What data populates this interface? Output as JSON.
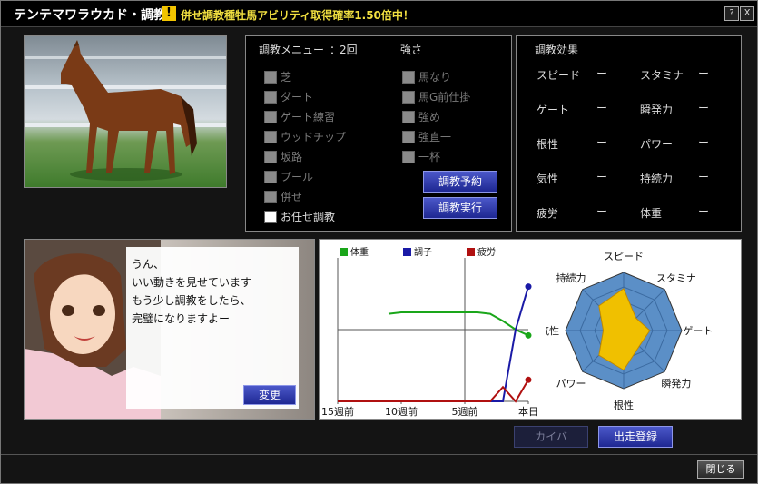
{
  "titlebar": {
    "title": "テンテマワラウカド・調教",
    "warning_glyph": "!",
    "ticker": "併せ調教種牡馬アビリティ取得確率1.50倍中！",
    "help_label": "?",
    "close_label": "X"
  },
  "menu": {
    "header": "調教メニュー",
    "sep": "：",
    "count": "2回",
    "strength_header": "強さ",
    "items": [
      {
        "label": "芝",
        "enabled": false
      },
      {
        "label": "ダート",
        "enabled": false
      },
      {
        "label": "ゲート練習",
        "enabled": false
      },
      {
        "label": "ウッドチップ",
        "enabled": false
      },
      {
        "label": "坂路",
        "enabled": false
      },
      {
        "label": "プール",
        "enabled": false
      },
      {
        "label": "併せ",
        "enabled": false
      },
      {
        "label": "お任せ調教",
        "enabled": true
      }
    ],
    "strengths": [
      "馬なり",
      "馬G前仕掛",
      "強め",
      "強直一",
      "一杯"
    ],
    "reserve_button": "調教予約",
    "execute_button": "調教実行"
  },
  "effects": {
    "header": "調教効果",
    "rows": [
      {
        "left": "スピード",
        "left_value": "ー",
        "right": "スタミナ",
        "right_value": "ー"
      },
      {
        "left": "ゲート",
        "left_value": "ー",
        "right": "瞬発力",
        "right_value": "ー"
      },
      {
        "left": "根性",
        "left_value": "ー",
        "right": "パワー",
        "right_value": "ー"
      },
      {
        "left": "気性",
        "left_value": "ー",
        "right": "持続力",
        "right_value": "ー"
      },
      {
        "left": "疲労",
        "left_value": "ー",
        "right": "体重",
        "right_value": "ー"
      }
    ]
  },
  "dialog": {
    "lines": [
      "うん、",
      "いい動きを見せています",
      "もう少し調教をしたら、",
      "完璧になりますよー"
    ],
    "change_button": "変更"
  },
  "colors": {
    "weight": "#1aa61a",
    "condition": "#1a1aa6",
    "fatigue": "#b01010",
    "radar_bg": "#5b8fc7",
    "radar_fill": "#f0c000"
  },
  "chart_data": [
    {
      "type": "line",
      "legend": [
        "体重",
        "調子",
        "疲労"
      ],
      "x_ticks": [
        "15週前",
        "10週前",
        "5週前",
        "本日"
      ],
      "x": [
        15,
        14,
        13,
        12,
        11,
        10,
        9,
        8,
        7,
        6,
        5,
        4,
        3,
        2,
        1,
        0
      ],
      "series": [
        {
          "name": "体重",
          "values": [
            null,
            null,
            null,
            null,
            61,
            62,
            62,
            62,
            62,
            62,
            62,
            62,
            61,
            56,
            50,
            46
          ]
        },
        {
          "name": "調子",
          "values": [
            0,
            0,
            0,
            0,
            0,
            0,
            0,
            0,
            0,
            0,
            0,
            0,
            0,
            0,
            50,
            80
          ]
        },
        {
          "name": "疲労",
          "values": [
            0,
            0,
            0,
            0,
            0,
            0,
            0,
            0,
            0,
            0,
            0,
            0,
            0,
            10,
            0,
            15
          ]
        }
      ],
      "ylim": [
        0,
        100
      ]
    },
    {
      "type": "radar",
      "axes": [
        "スピード",
        "スタミナ",
        "ゲート",
        "瞬発力",
        "根性",
        "パワー",
        "気性",
        "持続力"
      ],
      "values": [
        0.72,
        0.3,
        0.45,
        0.38,
        0.68,
        0.6,
        0.35,
        0.6
      ],
      "max": 1
    }
  ],
  "footer": {
    "kaiba_button": "カイバ",
    "entry_button": "出走登録",
    "close_button": "閉じる"
  }
}
